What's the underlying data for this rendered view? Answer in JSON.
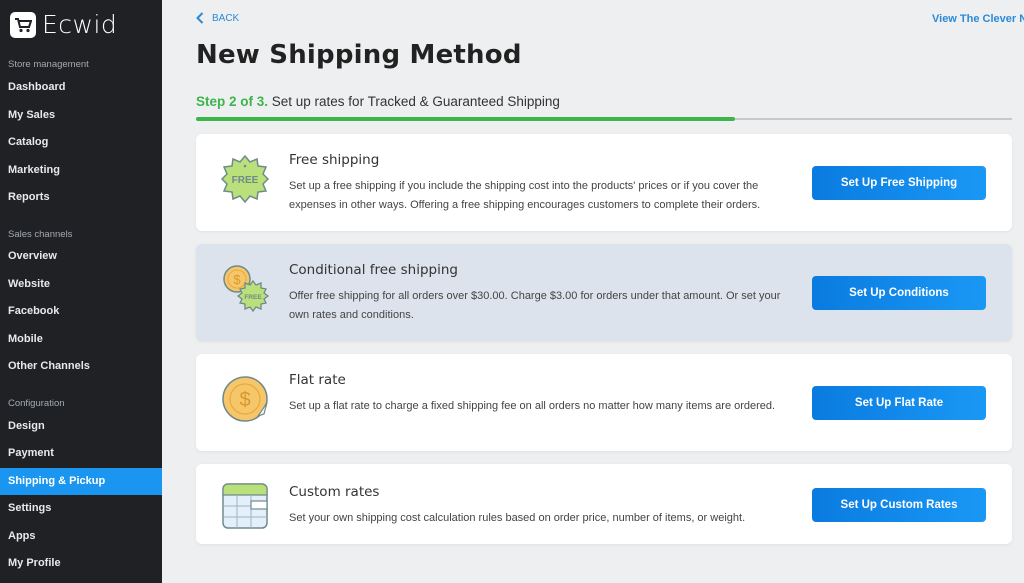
{
  "app": {
    "brand": "Ecwid"
  },
  "sidebar": {
    "sections": [
      {
        "label": "Store management",
        "items": [
          "Dashboard",
          "My Sales",
          "Catalog",
          "Marketing",
          "Reports"
        ]
      },
      {
        "label": "Sales channels",
        "items": [
          "Overview",
          "Website",
          "Facebook",
          "Mobile",
          "Other Channels"
        ]
      },
      {
        "label": "Configuration",
        "items": [
          "Design",
          "Payment",
          "Shipping & Pickup",
          "Settings",
          "Apps",
          "My Profile"
        ]
      }
    ],
    "active_item": "Shipping & Pickup"
  },
  "header": {
    "back_label": "BACK",
    "top_link": "View The Clever N",
    "page_title": "New Shipping Method",
    "step_prefix": "Step 2 of 3.",
    "step_text": " Set up rates for Tracked & Guaranteed Shipping",
    "progress_percent": 66
  },
  "methods": [
    {
      "icon": "free-badge-icon",
      "title": "Free shipping",
      "description": "Set up a free shipping if you include the shipping cost into the products' prices or if you cover the expenses in other ways. Offering a free shipping encourages customers to complete their orders.",
      "button": "Set Up Free Shipping",
      "highlighted": false
    },
    {
      "icon": "conditional-free-icon",
      "title": "Conditional free shipping",
      "description": "Offer free shipping for all orders over $30.00. Charge $3.00 for orders under that amount. Or set your own rates and conditions.",
      "button": "Set Up Conditions",
      "highlighted": true
    },
    {
      "icon": "coin-dollar-icon",
      "title": "Flat rate",
      "description": "Set up a flat rate to charge a fixed shipping fee on all orders no matter how many items are ordered.",
      "button": "Set Up Flat Rate",
      "highlighted": false
    },
    {
      "icon": "table-icon",
      "title": "Custom rates",
      "description": "Set your own shipping cost calculation rules based on order price, number of items, or weight.",
      "button": "Set Up Custom Rates",
      "highlighted": false
    }
  ],
  "colors": {
    "accent": "#1a95f0",
    "progress": "#3cb54a",
    "sidebar_bg": "#1f2125"
  }
}
